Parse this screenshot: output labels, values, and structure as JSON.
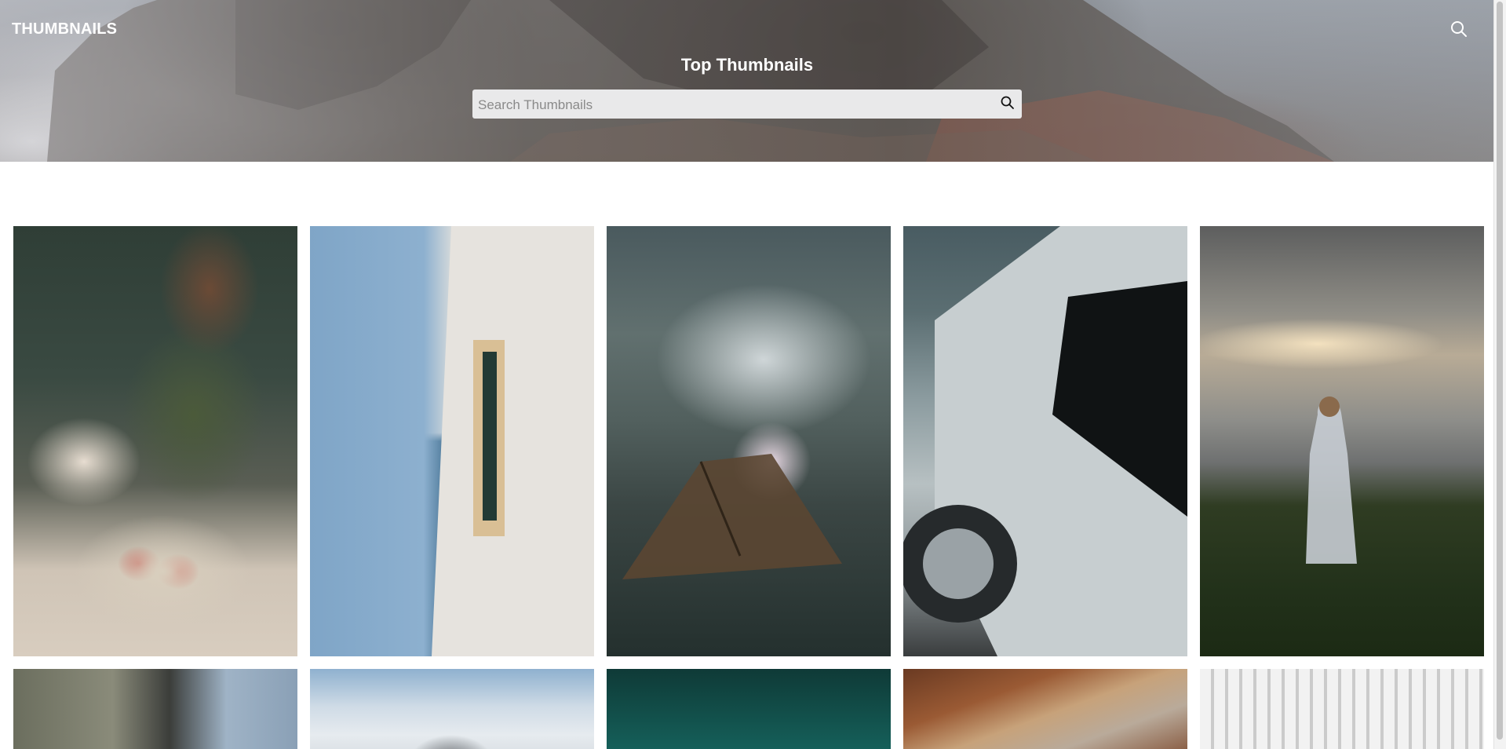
{
  "header": {
    "brand": "THUMBNAILS",
    "title": "Top Thumbnails",
    "search": {
      "placeholder": "Search Thumbnails",
      "value": ""
    },
    "icons": {
      "top_search": "search-icon",
      "field_search": "search-icon"
    }
  },
  "gallery": {
    "items": [
      {
        "subject": "woman-unpacking-groceries"
      },
      {
        "subject": "lighthouse-window-sea"
      },
      {
        "subject": "tent-mountains-night"
      },
      {
        "subject": "silver-classic-car"
      },
      {
        "subject": "woman-sunset-field"
      },
      {
        "subject": "palm-building"
      },
      {
        "subject": "snowy-peak-clouds"
      },
      {
        "subject": "teal-sky"
      },
      {
        "subject": "wooden-beams-brick"
      },
      {
        "subject": "white-folding-chairs"
      }
    ]
  },
  "colors": {
    "header_text": "#ffffff",
    "search_bg": "#e9e9ea",
    "page_bg": "#ffffff"
  }
}
